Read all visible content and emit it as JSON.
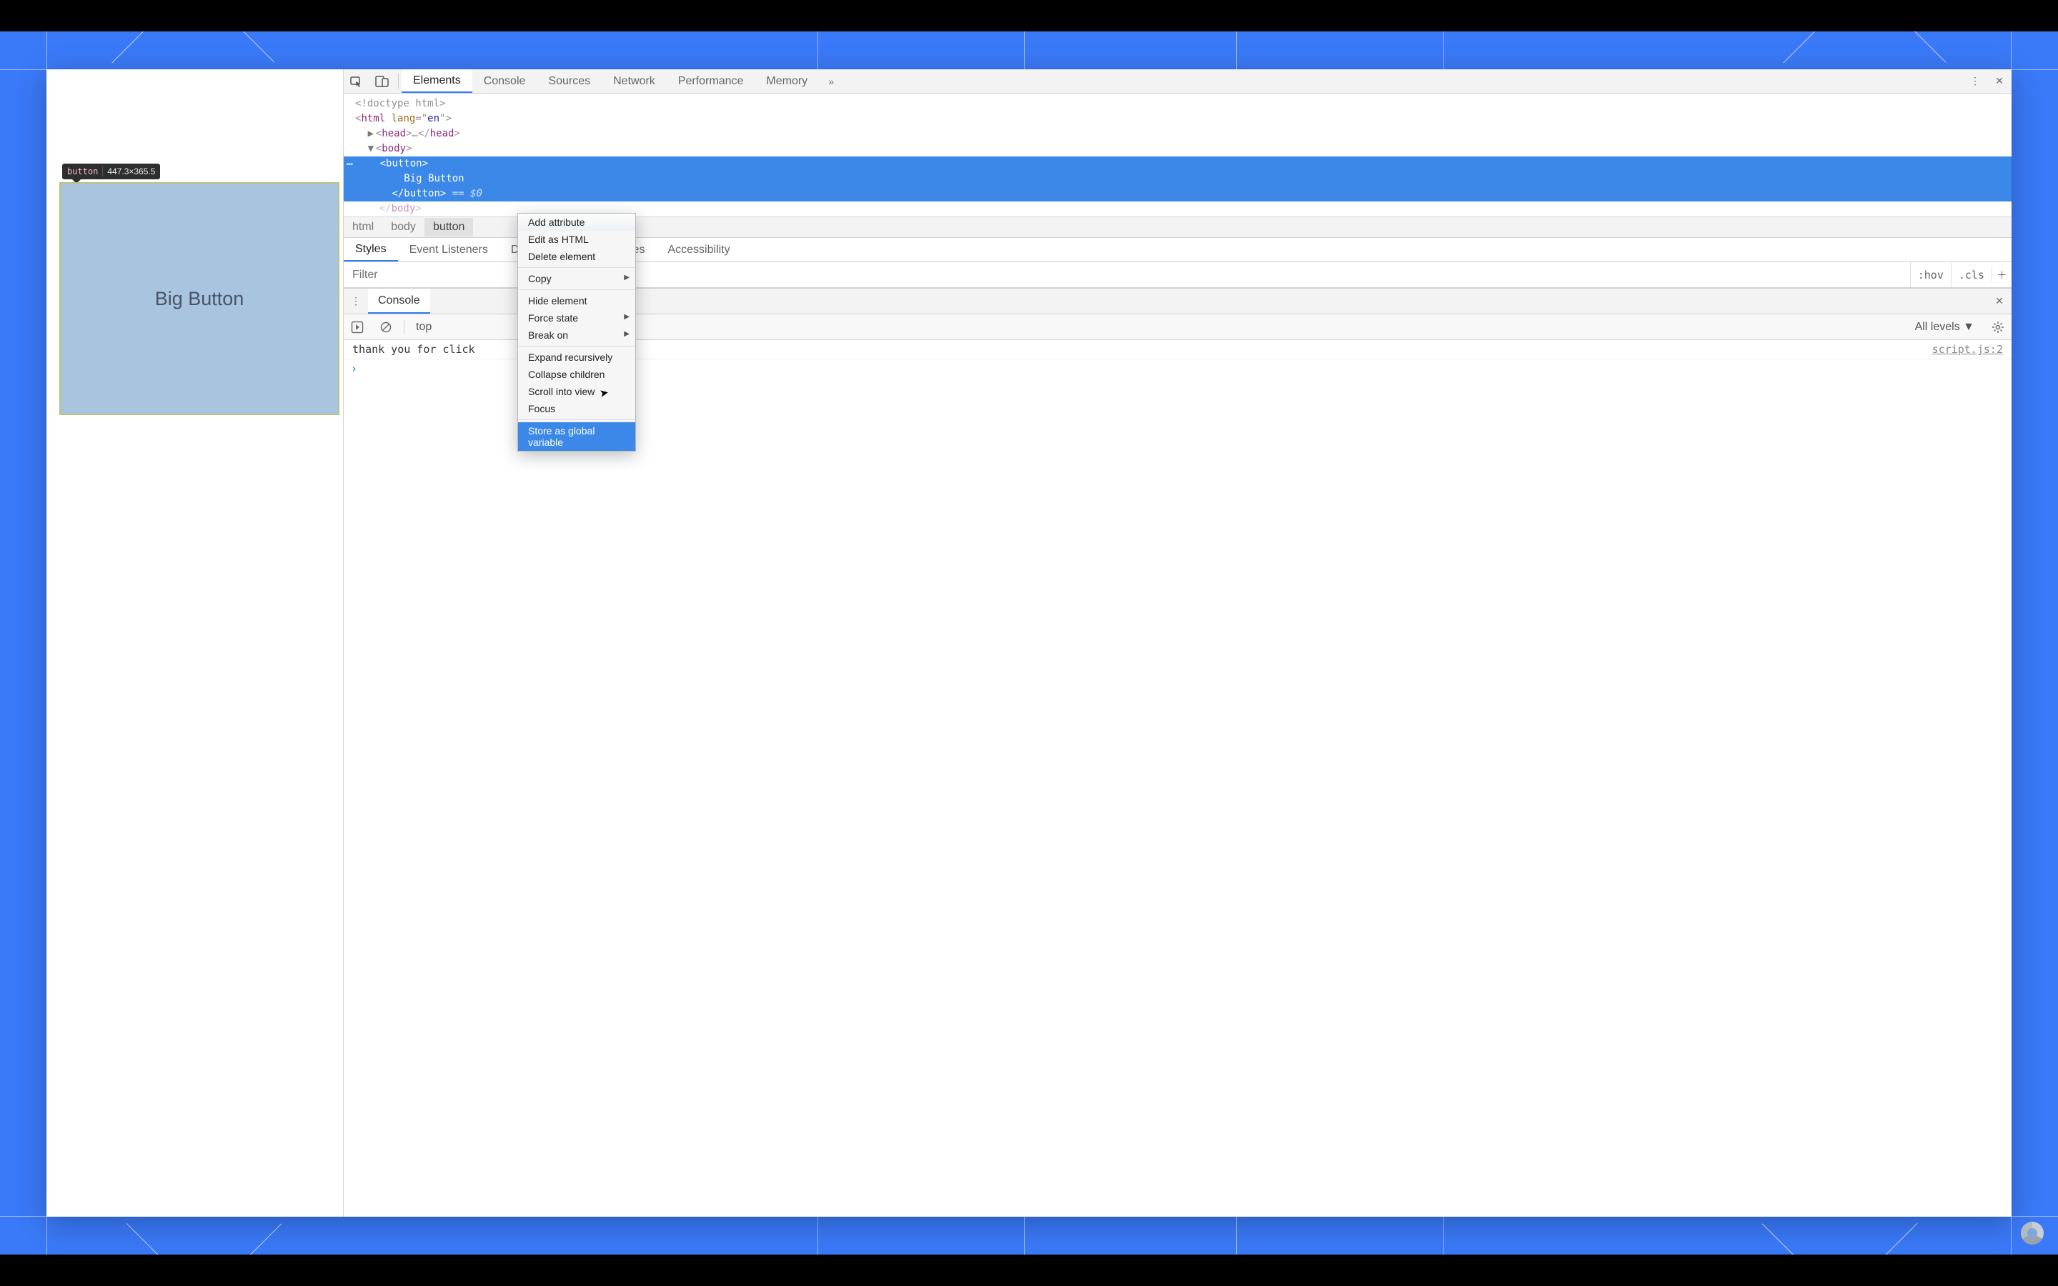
{
  "page": {
    "button_label": "Big Button",
    "inspect_tag": "button",
    "inspect_dims": "447.3×365.5"
  },
  "tabs": {
    "items": [
      "Elements",
      "Console",
      "Sources",
      "Network",
      "Performance",
      "Memory"
    ],
    "active": "Elements"
  },
  "dom": {
    "doctype": "<!doctype html>",
    "open_html": "<html lang=\"en\">",
    "head": "<head>…</head>",
    "open_body": "<body>",
    "open_button": "<button>",
    "button_text": "Big Button",
    "close_button": "</button>",
    "eqz": "== $0",
    "close_body_partial": "</body>"
  },
  "breadcrumb": [
    "html",
    "body",
    "button"
  ],
  "subtabs": [
    "Styles",
    "Event Listeners",
    "DOM Breakpoints",
    "Properties",
    "Accessibility"
  ],
  "filter": {
    "placeholder": "Filter",
    "hov": ":hov",
    "cls": ".cls"
  },
  "drawer": {
    "title": "Console",
    "context": "top",
    "levels": "All levels ▼"
  },
  "console": {
    "message": "thank you for click",
    "source": "script.js:2"
  },
  "ctx": {
    "items": [
      {
        "label": "Add attribute"
      },
      {
        "label": "Edit as HTML"
      },
      {
        "label": "Delete element"
      },
      {
        "sep": true
      },
      {
        "label": "Copy",
        "sub": true
      },
      {
        "sep": true
      },
      {
        "label": "Hide element"
      },
      {
        "label": "Force state",
        "sub": true
      },
      {
        "label": "Break on",
        "sub": true
      },
      {
        "sep": true
      },
      {
        "label": "Expand recursively"
      },
      {
        "label": "Collapse children"
      },
      {
        "label": "Scroll into view"
      },
      {
        "label": "Focus"
      },
      {
        "sep": true
      },
      {
        "label": "Store as global variable",
        "hl": true
      }
    ]
  }
}
